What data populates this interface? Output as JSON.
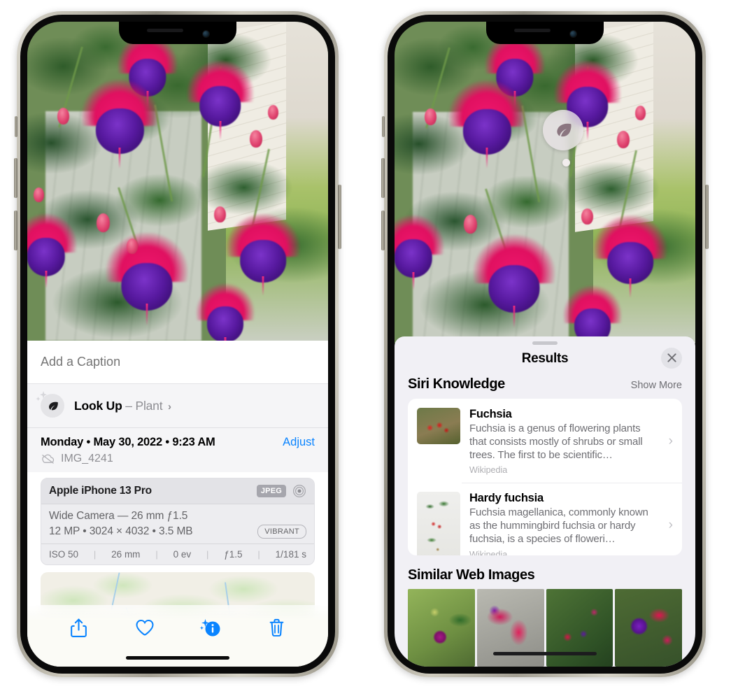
{
  "left_phone": {
    "name": "photo-detail-screen",
    "caption": {
      "placeholder": "Add a Caption",
      "value": ""
    },
    "lookup": {
      "label": "Look Up",
      "dash": "–",
      "subject": "Plant",
      "chevron": "›",
      "icon": "leaf-icon"
    },
    "date": {
      "text": "Monday • May 30, 2022 • 9:23 AM",
      "adjust_label": "Adjust",
      "file_name": "IMG_4241",
      "cloud_icon": "cloud-slash-icon"
    },
    "metadata": {
      "device": "Apple iPhone 13 Pro",
      "format_badge": "JPEG",
      "lens_icon": "aperture-icon",
      "lens": "Wide Camera — 26 mm ƒ1.5",
      "size": "12 MP • 3024 × 4032 • 3.5 MB",
      "style_badge": "VIBRANT",
      "exif": [
        "ISO 50",
        "26 mm",
        "0 ev",
        "ƒ1.5",
        "1/181 s"
      ],
      "exif_divider": "|"
    },
    "map": {
      "label": "photo-location-map"
    },
    "toolbar": [
      {
        "name": "share-button",
        "icon": "share-icon"
      },
      {
        "name": "favorite-button",
        "icon": "heart-icon"
      },
      {
        "name": "info-button",
        "icon": "info-sparkle-icon"
      },
      {
        "name": "delete-button",
        "icon": "trash-icon"
      }
    ],
    "accent_color": "#0a84ff"
  },
  "right_phone": {
    "name": "visual-lookup-results-screen",
    "bubble": {
      "icon": "leaf-icon"
    },
    "sheet": {
      "title": "Results",
      "close_icon": "close-icon",
      "siri_section": {
        "title": "Siri Knowledge",
        "show_more": "Show More",
        "cards": [
          {
            "title": "Fuchsia",
            "description": "Fuchsia is a genus of flowering plants that consists mostly of shrubs or small trees. The first to be scientific…",
            "source": "Wikipedia",
            "chevron": "›"
          },
          {
            "title": "Hardy fuchsia",
            "description": "Fuchsia magellanica, commonly known as the hummingbird fuchsia or hardy fuchsia, is a species of floweri…",
            "source": "Wikipedia",
            "chevron": "›"
          }
        ]
      },
      "similar_section": {
        "title": "Similar Web Images",
        "images": [
          "fuchsia-thumb-1",
          "fuchsia-thumb-2",
          "fuchsia-thumb-3",
          "fuchsia-thumb-4"
        ]
      }
    }
  }
}
